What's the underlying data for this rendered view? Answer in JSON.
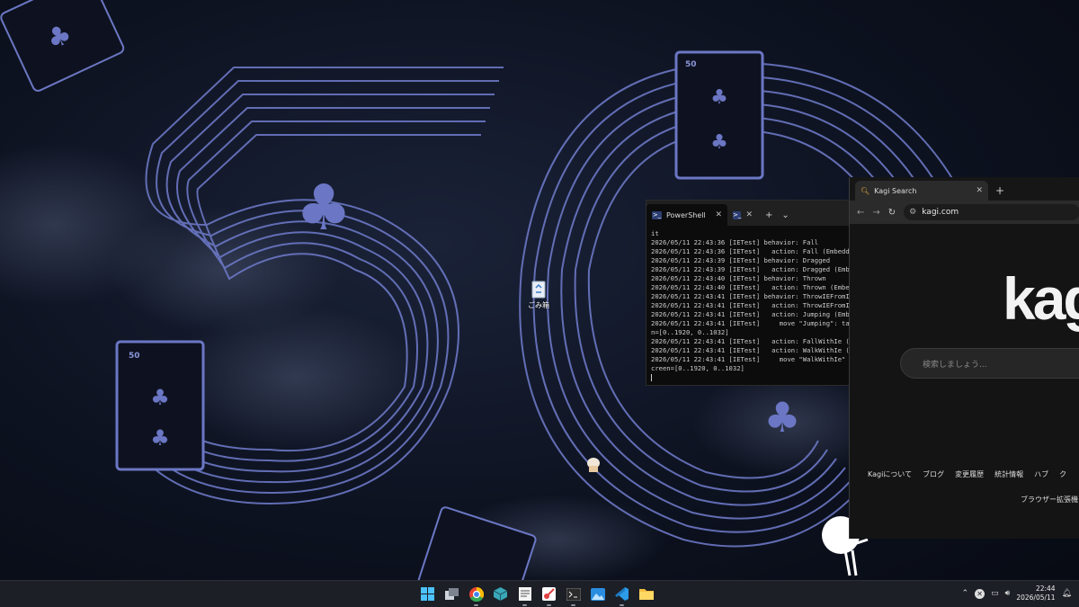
{
  "desktop": {
    "recycle_bin_label": "ごみ箱",
    "wallpaper": {
      "card_rank": "5",
      "card_suit": "club",
      "theme_color": "#6b77c4"
    }
  },
  "terminal": {
    "tab_active": "PowerShell",
    "lines": [
      "it",
      "2026/05/11 22:43:36 [IETest] behavior: Fall",
      "2026/05/11 22:43:36 [IETest]   action: Fall (Embedd",
      "2026/05/11 22:43:39 [IETest] behavior: Dragged",
      "2026/05/11 22:43:39 [IETest]   action: Dragged (Emb",
      "2026/05/11 22:43:40 [IETest] behavior: Thrown",
      "2026/05/11 22:43:40 [IETest]   action: Thrown (Embe",
      "2026/05/11 22:43:41 [IETest] behavior: ThrowIEFromI",
      "2026/05/11 22:43:41 [IETest]   action: ThrowIEFromI",
      "2026/05/11 22:43:41 [IETest]   action: Jumping (Emb",
      "2026/05/11 22:43:41 [IETest]     move \"Jumping\": ta",
      "n=[0..1920, 0..1032]",
      "2026/05/11 22:43:41 [IETest]   action: FallWithIe (",
      "2026/05/11 22:43:41 [IETest]   action: WalkWithIe (",
      "2026/05/11 22:43:41 [IETest]     move \"WalkWithIe\"",
      "creen=[0..1920, 0..1032]"
    ]
  },
  "browser": {
    "tab_title": "Kagi Search",
    "address": "kagi.com",
    "logo_text": "kagi",
    "search_placeholder": "検索しましょう...",
    "footer_links": [
      "Kagiについて",
      "ブログ",
      "変更履歴",
      "統計情報",
      "ハブ",
      "ク"
    ],
    "extension_text": "ブラウザー拡張機"
  },
  "taskbar": {
    "apps": [
      "windows-start",
      "task-view",
      "chrome",
      "package-manager",
      "notepad",
      "snipping-tool",
      "terminal",
      "photos",
      "vscode",
      "file-explorer"
    ],
    "time": "22:44",
    "date": "2026/05/11"
  }
}
